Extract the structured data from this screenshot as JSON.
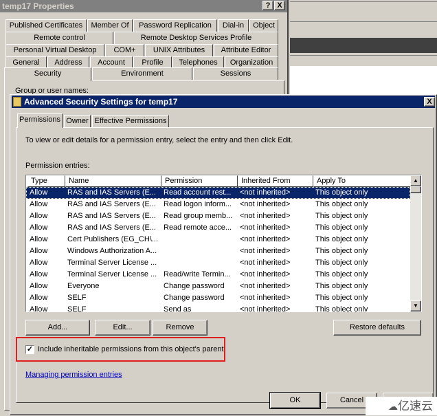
{
  "background_window": {
    "title": "temp17 Properties",
    "help_label": "?",
    "close_label": "X",
    "tab_rows": [
      [
        "Published Certificates",
        "Member Of",
        "Password Replication",
        "Dial-in",
        "Object"
      ],
      [
        "Remote control",
        "Remote Desktop Services Profile"
      ],
      [
        "Personal Virtual Desktop",
        "COM+",
        "UNIX Attributes",
        "Attribute Editor"
      ],
      [
        "General",
        "Address",
        "Account",
        "Profile",
        "Telephones",
        "Organization"
      ],
      [
        "Security",
        "Environment",
        "Sessions"
      ]
    ],
    "selected_tab": "Security",
    "group_label": "Group or user names:"
  },
  "dialog": {
    "title": "Advanced Security Settings for temp17",
    "close_label": "X",
    "tabs": [
      "Permissions",
      "Owner",
      "Effective Permissions"
    ],
    "selected_tab": "Permissions",
    "instructions": "To view or edit details for a permission entry, select the entry and then click Edit.",
    "entries_label": "Permission entries:",
    "columns": [
      "Type",
      "Name",
      "Permission",
      "Inherited From",
      "Apply To"
    ],
    "rows": [
      [
        "Allow",
        "RAS and IAS Servers (E...",
        "Read account rest...",
        "<not inherited>",
        "This object only"
      ],
      [
        "Allow",
        "RAS and IAS Servers (E...",
        "Read logon inform...",
        "<not inherited>",
        "This object only"
      ],
      [
        "Allow",
        "RAS and IAS Servers (E...",
        "Read group memb...",
        "<not inherited>",
        "This object only"
      ],
      [
        "Allow",
        "RAS and IAS Servers (E...",
        "Read remote acce...",
        "<not inherited>",
        "This object only"
      ],
      [
        "Allow",
        "Cert Publishers (EG_CH\\...",
        "",
        "<not inherited>",
        "This object only"
      ],
      [
        "Allow",
        "Windows Authorization A...",
        "",
        "<not inherited>",
        "This object only"
      ],
      [
        "Allow",
        "Terminal Server License ...",
        "",
        "<not inherited>",
        "This object only"
      ],
      [
        "Allow",
        "Terminal Server License ...",
        "Read/write Termin...",
        "<not inherited>",
        "This object only"
      ],
      [
        "Allow",
        "Everyone",
        "Change password",
        "<not inherited>",
        "This object only"
      ],
      [
        "Allow",
        "SELF",
        "Change password",
        "<not inherited>",
        "This object only"
      ],
      [
        "Allow",
        "SELF",
        "Send as",
        "<not inherited>",
        "This object only"
      ]
    ],
    "selected_row": 0,
    "buttons": {
      "add": "Add...",
      "edit": "Edit...",
      "remove": "Remove",
      "restore": "Restore defaults",
      "ok": "OK",
      "cancel": "Cancel"
    },
    "inherit_checkbox": {
      "label": "Include inheritable permissions from this object's parent",
      "checked": true
    },
    "link": "Managing permission entries",
    "highlight_color": "#e02020"
  },
  "watermark": {
    "text": "亿速云"
  }
}
